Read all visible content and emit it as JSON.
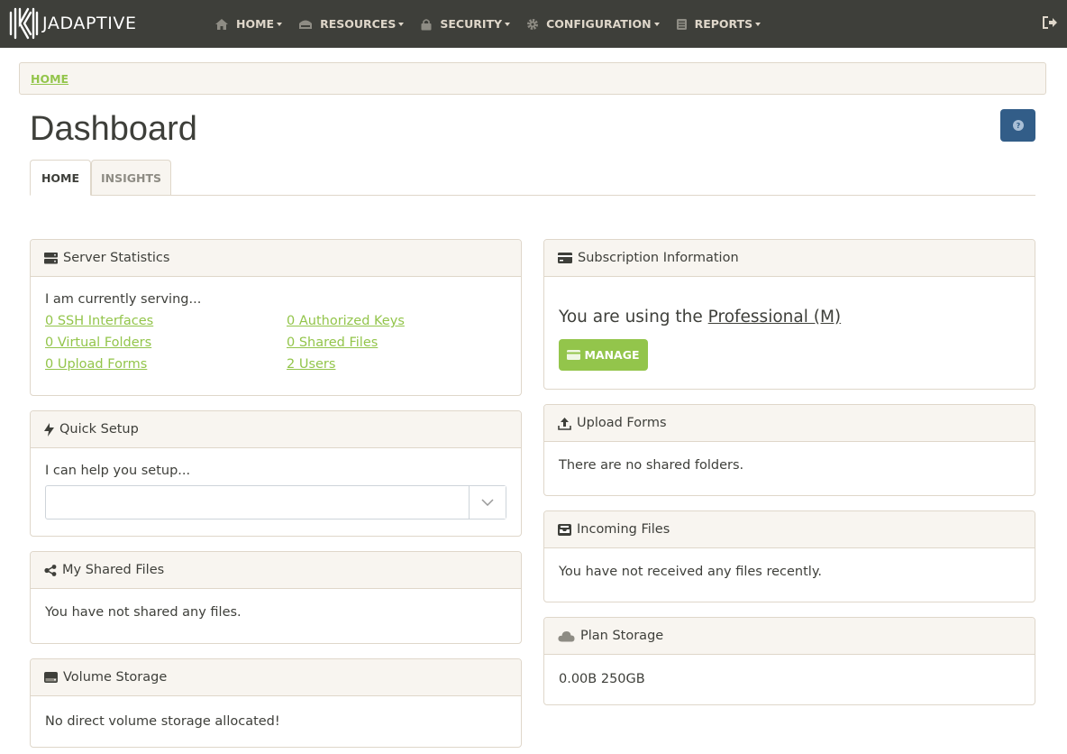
{
  "navbar": {
    "brand": "JADAPTIVE",
    "items": [
      {
        "label": "HOME",
        "icon": "home-icon"
      },
      {
        "label": "RESOURCES",
        "icon": "resources-icon"
      },
      {
        "label": "SECURITY",
        "icon": "lock-icon"
      },
      {
        "label": "CONFIGURATION",
        "icon": "gear-icon"
      },
      {
        "label": "REPORTS",
        "icon": "reports-icon"
      }
    ],
    "logout_icon": "sign-out-icon"
  },
  "breadcrumb": {
    "home": "HOME"
  },
  "page": {
    "title": "Dashboard",
    "help_icon": "question-icon"
  },
  "tabs": [
    {
      "label": "HOME",
      "active": true
    },
    {
      "label": "INSIGHTS",
      "active": false
    }
  ],
  "server_statistics": {
    "title": "Server Statistics",
    "intro": "I am currently serving...",
    "links": [
      "0 SSH Interfaces",
      "0 Authorized Keys",
      "0 Virtual Folders",
      "0 Shared Files",
      "0 Upload Forms",
      "2 Users"
    ]
  },
  "quick_setup": {
    "title": "Quick Setup",
    "intro": "I can help you setup...",
    "selected": ""
  },
  "my_shared_files": {
    "title": "My Shared Files",
    "text": "You have not shared any files."
  },
  "volume_storage": {
    "title": "Volume Storage",
    "text": "No direct volume storage allocated!"
  },
  "subscription": {
    "title": "Subscription Information",
    "using_prefix": "You are using the ",
    "plan": "Professional (M)",
    "manage_label": "MANAGE"
  },
  "upload_forms": {
    "title": "Upload Forms",
    "text": "There are no shared folders."
  },
  "incoming_files": {
    "title": "Incoming Files",
    "text": "You have not received any files recently."
  },
  "plan_storage": {
    "title": "Plan Storage",
    "text": "0.00B 250GB"
  },
  "colors": {
    "navbar": "#3e3f3a",
    "accent_green": "#93c54b",
    "help_blue": "#325d88",
    "panel_bg": "#f8f5f0",
    "border": "#dfd7ca"
  }
}
